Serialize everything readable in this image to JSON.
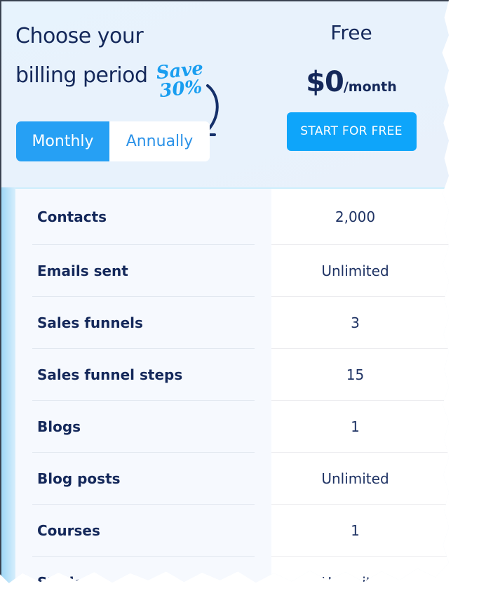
{
  "billing": {
    "title": "Choose your billing period",
    "save_note_line1": "Save",
    "save_note_line2": "30%",
    "toggle": {
      "options": [
        {
          "label": "Monthly",
          "active": true
        },
        {
          "label": "Annually",
          "active": false
        }
      ]
    }
  },
  "plan": {
    "name": "Free",
    "price_amount": "$0",
    "price_unit": "/month",
    "cta_label": "START FOR FREE"
  },
  "features": [
    {
      "label": "Contacts",
      "value": "2,000"
    },
    {
      "label": "Emails sent",
      "value": "Unlimited"
    },
    {
      "label": "Sales funnels",
      "value": "3"
    },
    {
      "label": "Sales funnel steps",
      "value": "15"
    },
    {
      "label": "Blogs",
      "value": "1"
    },
    {
      "label": "Blog posts",
      "value": "Unlimited"
    },
    {
      "label": "Courses",
      "value": "1"
    },
    {
      "label": "Students",
      "value": "Unlimited"
    }
  ],
  "colors": {
    "accent": "#26a0f4",
    "cta": "#0ea5fa",
    "text_dark": "#14285a",
    "save_note": "#1a9ef0"
  }
}
